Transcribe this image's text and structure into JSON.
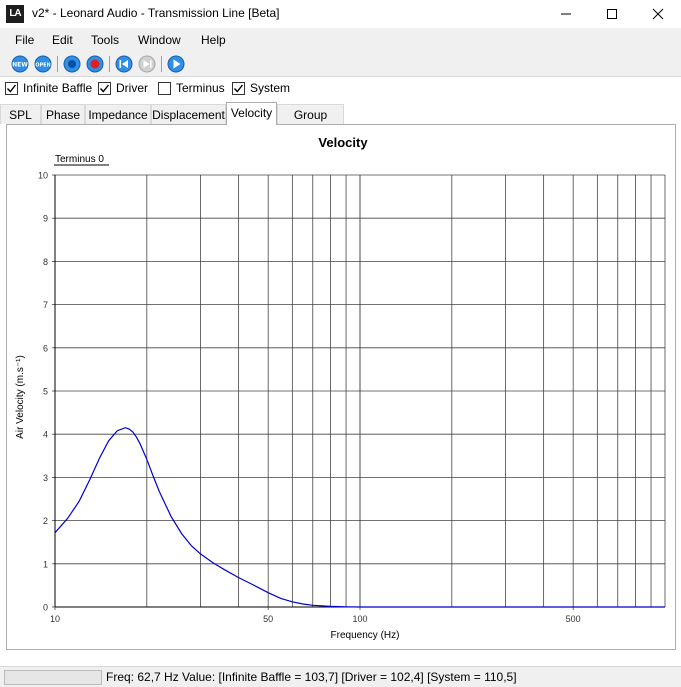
{
  "window": {
    "logo_text": "LA",
    "title": "v2* - Leonard Audio - Transmission Line [Beta]"
  },
  "menu": [
    "File",
    "Edit",
    "Tools",
    "Window",
    "Help"
  ],
  "toolbar": {
    "new_label": "NEW",
    "open_label": "OPEN"
  },
  "checkboxes": [
    {
      "label": "Infinite Baffle",
      "checked": true
    },
    {
      "label": "Driver",
      "checked": true
    },
    {
      "label": "Terminus",
      "checked": false
    },
    {
      "label": "System",
      "checked": true
    }
  ],
  "tabs": [
    {
      "label": "SPL",
      "active": false
    },
    {
      "label": "Phase",
      "active": false
    },
    {
      "label": "Impedance",
      "active": false
    },
    {
      "label": "Displacement",
      "active": false
    },
    {
      "label": "Velocity",
      "active": true
    },
    {
      "label": "Group Delay",
      "active": false
    }
  ],
  "chart_data": {
    "type": "line",
    "title": "Velocity",
    "legend": "Terminus 0",
    "xlabel": "Frequency (Hz)",
    "ylabel": "Air Velocity (m.s⁻¹)",
    "xscale": "log",
    "xlim": [
      10,
      1000
    ],
    "ylim": [
      0,
      10
    ],
    "x_tick_labels": [
      {
        "value": 10,
        "label": "10"
      },
      {
        "value": 50,
        "label": "50"
      },
      {
        "value": 100,
        "label": "100"
      },
      {
        "value": 500,
        "label": "500"
      }
    ],
    "y_ticks": [
      0,
      1,
      2,
      3,
      4,
      5,
      6,
      7,
      8,
      9,
      10
    ],
    "grid": true,
    "line_color": "#0000cc",
    "series": [
      {
        "x": [
          10,
          11,
          12,
          13,
          14,
          15,
          16,
          17,
          17.5,
          18,
          18.5,
          19,
          20,
          21,
          22,
          24,
          26,
          28,
          30,
          33,
          36,
          40,
          45,
          50,
          55,
          60,
          65,
          70,
          80,
          90,
          100,
          200,
          500,
          1000
        ],
        "y": [
          1.72,
          2.05,
          2.45,
          2.95,
          3.45,
          3.85,
          4.08,
          4.15,
          4.12,
          4.05,
          3.93,
          3.78,
          3.42,
          3.02,
          2.67,
          2.1,
          1.7,
          1.42,
          1.23,
          1.02,
          0.86,
          0.68,
          0.5,
          0.33,
          0.2,
          0.12,
          0.07,
          0.04,
          0.015,
          0.005,
          0.0,
          0.0,
          0.0,
          0.0
        ]
      }
    ]
  },
  "status": {
    "progress": 0.0,
    "text": "Freq: 62,7 Hz   Value: [Infinite Baffle = 103,7]  [Driver = 102,4]  [System = 110,5]"
  }
}
